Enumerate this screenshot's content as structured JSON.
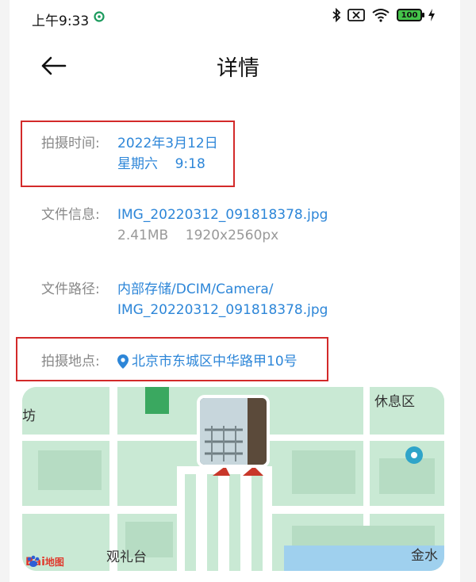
{
  "status": {
    "time": "上午9:33",
    "battery": "100"
  },
  "header": {
    "title": "详情"
  },
  "details": {
    "shoot_time_label": "拍摄时间:",
    "shoot_date": "2022年3月12日",
    "shoot_weekday_time": "星期六    9:18",
    "file_info_label": "文件信息:",
    "file_name": "IMG_20220312_091818378.jpg",
    "file_meta": "2.41MB    1920x2560px",
    "file_path_label": "文件路径:",
    "file_path_line1": "内部存储/DCIM/Camera/",
    "file_path_line2": "IMG_20220312_091818378.jpg",
    "location_label": "拍摄地点:",
    "location": "北京市东城区中华路甲10号"
  },
  "map": {
    "label_top_left": "坊",
    "label_rest_area": "休息区",
    "label_guanlitai": "观礼台",
    "label_jinshui": "金水",
    "logo_left": "Bai",
    "logo_right": "地图"
  },
  "colors": {
    "link": "#2d86d8",
    "highlight": "#d32a2a",
    "map_green": "#c9e9d4"
  }
}
